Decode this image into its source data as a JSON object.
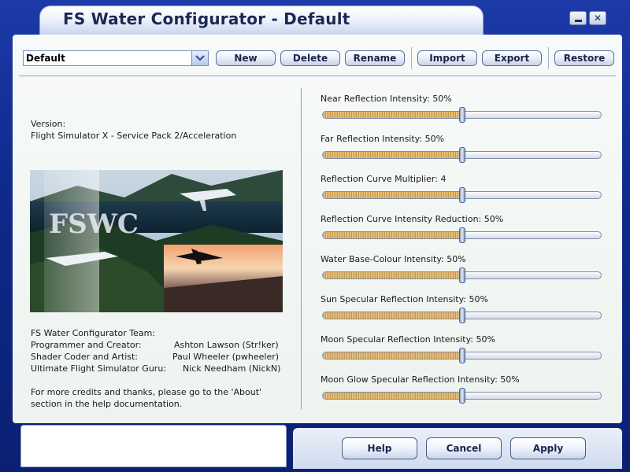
{
  "window": {
    "title": "FS Water Configurator - Default",
    "minimize_icon": "minimize-icon",
    "close_icon": "close-icon",
    "close_glyph": "✕"
  },
  "toolbar": {
    "preset_value": "Default",
    "buttons": [
      "New",
      "Delete",
      "Rename",
      "Import",
      "Export",
      "Restore"
    ]
  },
  "info": {
    "version_label": "Version:",
    "version_value": "Flight Simulator X - Service Pack 2/Acceleration",
    "logo_text": "FSWC",
    "team_heading": "FS Water Configurator Team:",
    "team": [
      {
        "role": "Programmer and Creator:",
        "name": "Ashton Lawson (Str!ker)"
      },
      {
        "role": "Shader Coder and Artist:",
        "name": "Paul Wheeler (pwheeler)"
      },
      {
        "role": "Ultimate Flight Simulator Guru:",
        "name": "Nick Needham (NickN)"
      }
    ],
    "credits_line1": "For more credits and thanks, please go to the 'About'",
    "credits_line2": "section in the help documentation."
  },
  "sliders": [
    {
      "label": "Near Reflection Intensity:  50%",
      "level": 0.5
    },
    {
      "label": "Far Reflection Intensity:  50%",
      "level": 0.5
    },
    {
      "label": "Reflection Curve Multiplier:  4",
      "level": 0.5
    },
    {
      "label": "Reflection Curve Intensity Reduction:  50%",
      "level": 0.5
    },
    {
      "label": "Water Base-Colour Intensity:  50%",
      "level": 0.5
    },
    {
      "label": "Sun Specular Reflection Intensity:  50%",
      "level": 0.5
    },
    {
      "label": "Moon Specular Reflection Intensity:  50%",
      "level": 0.5
    },
    {
      "label": "Moon Glow Specular Reflection Intensity:  50%",
      "level": 0.5
    }
  ],
  "footer": {
    "buttons": [
      "Help",
      "Cancel",
      "Apply"
    ],
    "status_text": ""
  },
  "colors": {
    "frame_blue": "#0f2a8c",
    "panel_bg": "#f3f7f4",
    "slider_fill": "#d9a85a"
  }
}
